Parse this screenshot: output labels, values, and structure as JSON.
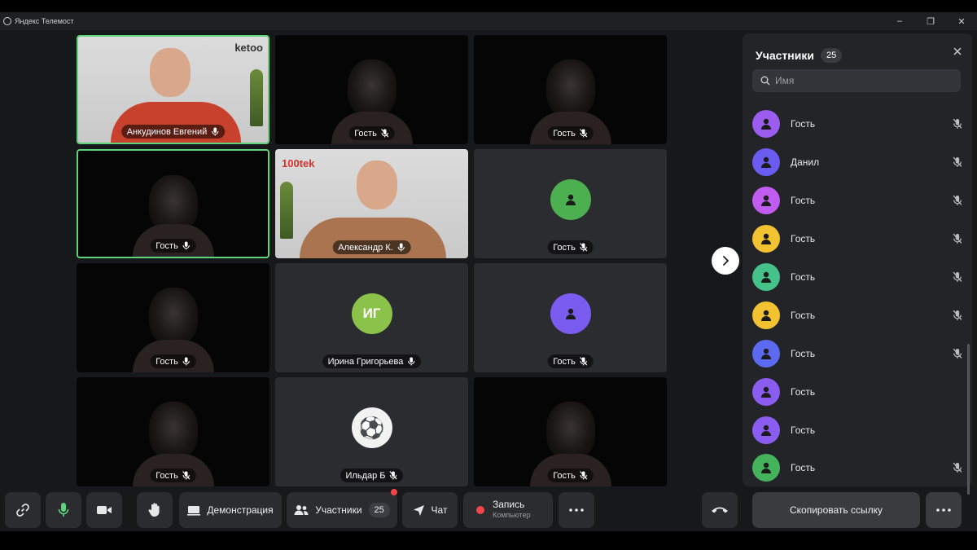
{
  "app": {
    "title": "Яндекс Телемост"
  },
  "window_controls": {
    "minimize": "–",
    "maximize": "❐",
    "close": "✕"
  },
  "tiles": [
    {
      "name": "Анкудинов Евгений",
      "kind": "video",
      "speaking": true,
      "mic": "on",
      "logo": "ketoo"
    },
    {
      "name": "Гость",
      "kind": "video",
      "speaking": false,
      "mic": "muted"
    },
    {
      "name": "Гость",
      "kind": "video",
      "speaking": false,
      "mic": "muted"
    },
    {
      "name": "Гость",
      "kind": "video",
      "speaking": true,
      "mic": "on"
    },
    {
      "name": "Александр К.",
      "kind": "video",
      "speaking": false,
      "mic": "on",
      "logo": "100tek"
    },
    {
      "name": "Гость",
      "kind": "avatar",
      "speaking": false,
      "mic": "muted",
      "avatar_color": "#4caf50"
    },
    {
      "name": "Гость",
      "kind": "video",
      "speaking": false,
      "mic": "on"
    },
    {
      "name": "Ирина Григорьева",
      "kind": "avatar",
      "speaking": false,
      "mic": "on",
      "avatar_color": "#8bc34a",
      "initials": "ИГ"
    },
    {
      "name": "Гость",
      "kind": "avatar",
      "speaking": false,
      "mic": "muted",
      "avatar_color": "#7b5cf0"
    },
    {
      "name": "Гость",
      "kind": "video",
      "speaking": false,
      "mic": "muted"
    },
    {
      "name": "Ильдар Б",
      "kind": "avatar",
      "speaking": false,
      "mic": "muted",
      "avatar_color": "#f2f2f2",
      "emoji": "⚽"
    },
    {
      "name": "Гость",
      "kind": "video",
      "speaking": false,
      "mic": "muted"
    }
  ],
  "next_page_icon": "chevron-right-icon",
  "panel": {
    "title": "Участники",
    "count": "25",
    "search_placeholder": "Имя",
    "participants": [
      {
        "name": "Гость",
        "color": "#9b5cf0",
        "muted": true
      },
      {
        "name": "Данил",
        "color": "#6a5cf0",
        "muted": true
      },
      {
        "name": "Гость",
        "color": "#c15cf0",
        "muted": true
      },
      {
        "name": "Гость",
        "color": "#f2c230",
        "muted": true
      },
      {
        "name": "Гость",
        "color": "#45c28a",
        "muted": true
      },
      {
        "name": "Гость",
        "color": "#f2c230",
        "muted": true
      },
      {
        "name": "Гость",
        "color": "#5c6af0",
        "muted": true
      },
      {
        "name": "Гость",
        "color": "#8a5cf0",
        "muted": false
      },
      {
        "name": "Гость",
        "color": "#8a5cf0",
        "muted": false
      },
      {
        "name": "Гость",
        "color": "#45b25c",
        "muted": true
      }
    ],
    "copy_link_label": "Скопировать ссылку"
  },
  "toolbar": {
    "screen_share_label": "Демонстрация",
    "participants_label": "Участники",
    "participants_count": "25",
    "chat_label": "Чат",
    "record_label": "Запись",
    "record_sub": "Компьютер"
  },
  "colors": {
    "accent_speaking": "#5fd37b",
    "record": "#f2464a",
    "panel_bg": "#232427"
  }
}
